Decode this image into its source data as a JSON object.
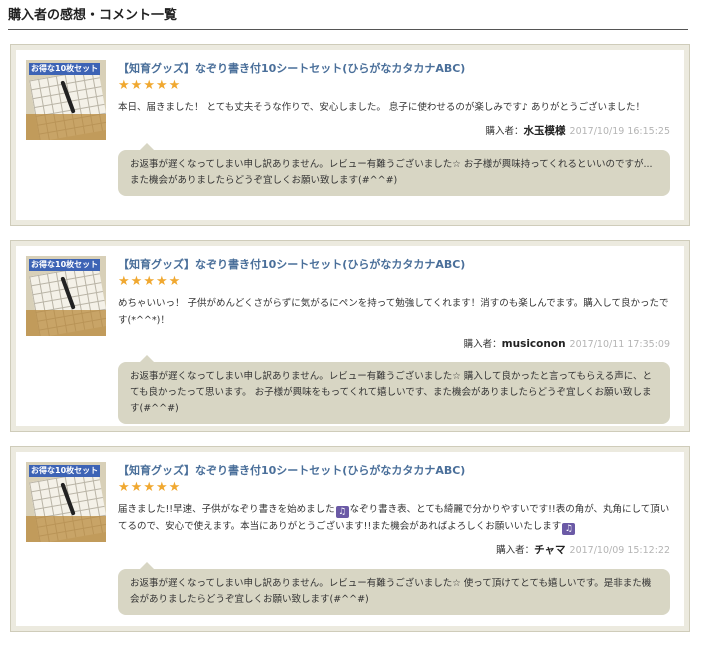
{
  "page": {
    "title": "購入者の感想・コメント一覧"
  },
  "colors": {
    "card_background": "#eceadf",
    "reply_background": "#d8d6c4",
    "product_link": "#4a6f9a",
    "star": "#f0a830",
    "date": "#b4b4b4"
  },
  "icons": {
    "star": "star-icon",
    "music_note": "music-note-icon"
  },
  "reviews": [
    {
      "thumbnail_label": "お得な10枚セット",
      "product_title": "【知育グッズ】なぞり書き付10シートセット(ひらがなカタカナABC)",
      "rating": 5,
      "comment": "本日、届きました！ とても丈夫そうな作りで、安心しました。 息子に使わせるのが楽しみです♪ ありがとうございました！",
      "reviewer_prefix": "購入者：",
      "reviewer": "水玉模様",
      "date": "2017/10/19 16:15:25",
      "reply": "お返事が遅くなってしまい申し訳ありません。レビュー有難うございました☆ お子様が興味持ってくれるといいのですが...また機会がありましたらどうぞ宜しくお願い致します(#^^#)"
    },
    {
      "thumbnail_label": "お得な10枚セット",
      "product_title": "【知育グッズ】なぞり書き付10シートセット(ひらがなカタカナABC)",
      "rating": 5,
      "comment": "めちゃいいっ！ 子供がめんどくさがらずに気がるにペンを持って勉強してくれます！消すのも楽しんでます。購入して良かったです(*^^*)！",
      "reviewer_prefix": "購入者：",
      "reviewer": "musiconon",
      "date": "2017/10/11 17:35:09",
      "reply": "お返事が遅くなってしまい申し訳ありません。レビュー有難うございました☆ 購入して良かったと言ってもらえる声に、とても良かったって思います。 お子様が興味をもってくれて嬉しいです、また機会がありましたらどうぞ宜しくお願い致します(#^^#)"
    },
    {
      "thumbnail_label": "お得な10枚セット",
      "product_title": "【知育グッズ】なぞり書き付10シートセット(ひらがなカタカナABC)",
      "rating": 5,
      "comment_part1": "届きました!!早速、子供がなぞり書きを始めました",
      "comment_part2": "なぞり書き表、とても綺麗で分かりやすいです!!表の角が、丸角にして頂いてるので、安心で使えます。本当にありがとうございます!!また機会があればよろしくお願いいたします",
      "reviewer_prefix": "購入者：",
      "reviewer": "チャマ",
      "date": "2017/10/09 15:12:22",
      "reply": "お返事が遅くなってしまい申し訳ありません。レビュー有難うございました☆ 使って頂けてとても嬉しいです。是非また機会がありましたらどうぞ宜しくお願い致します(#^^#)"
    }
  ]
}
